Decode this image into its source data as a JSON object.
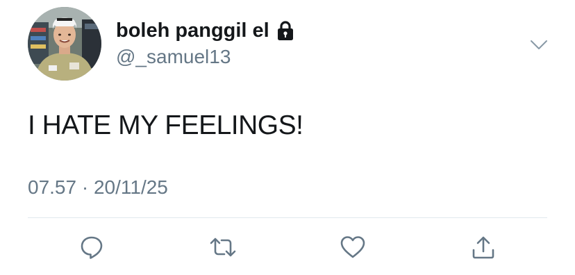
{
  "user": {
    "display_name": "boleh panggil el",
    "handle": "@_samuel13",
    "protected_icon": "lock-icon",
    "avatar_icon": "profile-photo"
  },
  "tweet": {
    "text": "I HATE MY FEELINGS!",
    "timestamp": "07.57 · 20/11/25"
  },
  "menu": {
    "icon": "chevron-down-icon"
  },
  "actions": [
    {
      "name": "reply",
      "icon": "speech-bubble-icon"
    },
    {
      "name": "retweet",
      "icon": "retweet-icon"
    },
    {
      "name": "like",
      "icon": "heart-icon"
    },
    {
      "name": "share",
      "icon": "share-icon"
    }
  ],
  "colors": {
    "text_primary": "#14171a",
    "text_secondary": "#657786",
    "icon": "#657786",
    "divider": "#e1e8ed"
  }
}
